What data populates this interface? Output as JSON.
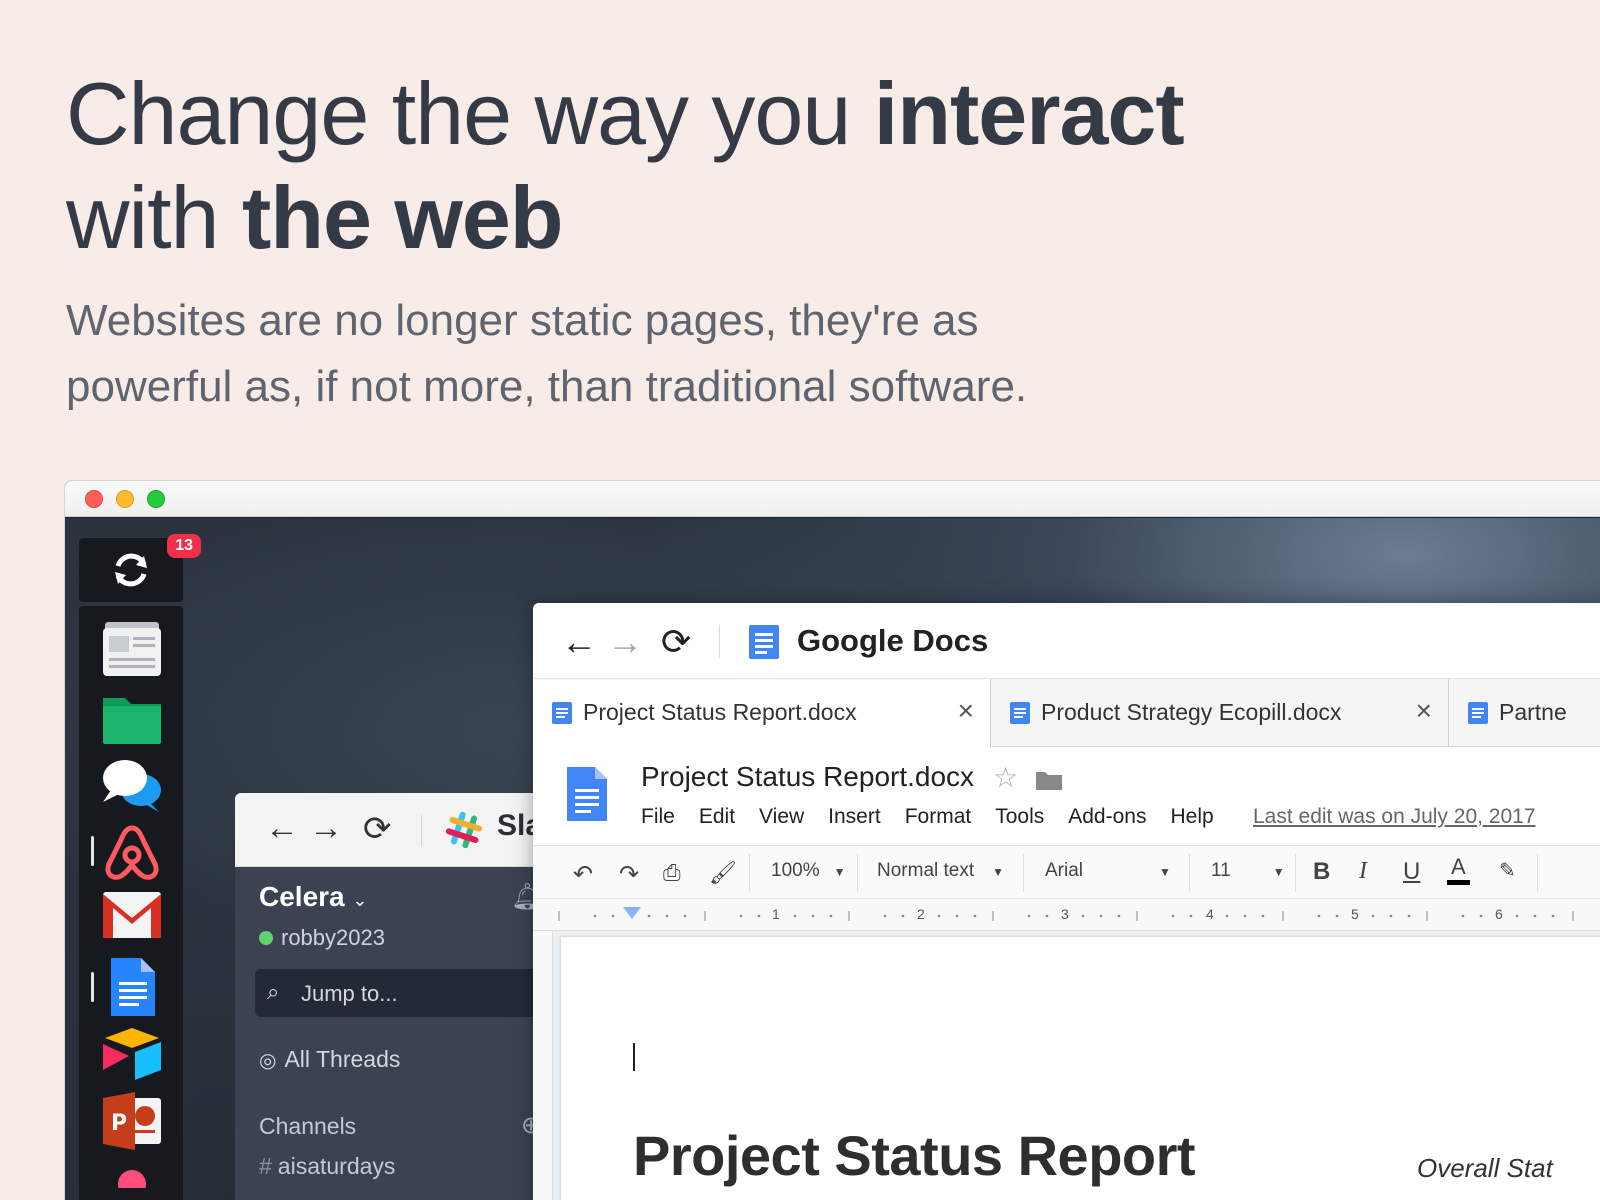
{
  "hero": {
    "line1_normal": "Change the way you ",
    "line1_bold": "interact",
    "line2_normal": "with ",
    "line2_bold": "the web",
    "subtitle_line1": "Websites are no longer static pages, they're as",
    "subtitle_line2": "powerful as, if not more, than traditional software."
  },
  "dock": {
    "badge_count": "13"
  },
  "slack": {
    "title": "Sla",
    "workspace": "Celera",
    "workspace_caret": "⌄",
    "username": "robby2023",
    "jump_label": "Jump to...",
    "threads_label": "All Threads",
    "channels_label": "Channels",
    "channel_item": "aisaturdays"
  },
  "gdocs": {
    "app_name": "Google Docs",
    "tabs": [
      {
        "label": "Project Status Report.docx"
      },
      {
        "label": "Product Strategy Ecopill.docx"
      },
      {
        "label": "Partne"
      }
    ],
    "doc_title": "Project Status Report.docx",
    "menu": [
      "File",
      "Edit",
      "View",
      "Insert",
      "Format",
      "Tools",
      "Add-ons",
      "Help"
    ],
    "last_edit": "Last edit was on July 20, 2017",
    "toolbar": {
      "zoom": "100%",
      "style": "Normal text",
      "font": "Arial",
      "size": "11"
    },
    "ruler_marks": [
      "1",
      "2",
      "3",
      "4",
      "5",
      "6"
    ],
    "page_heading": "Project Status Report",
    "page_side": "Overall Stat"
  }
}
